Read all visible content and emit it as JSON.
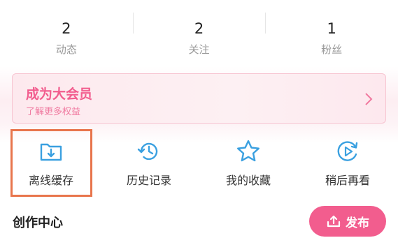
{
  "stats": [
    {
      "value": "2",
      "label": "动态"
    },
    {
      "value": "2",
      "label": "关注"
    },
    {
      "value": "1",
      "label": "粉丝"
    }
  ],
  "vip_banner": {
    "title": "成为大会员",
    "subtitle": "了解更多权益"
  },
  "menu": [
    {
      "label": "离线缓存",
      "icon": "offline-download-folder-icon",
      "highlighted": true
    },
    {
      "label": "历史记录",
      "icon": "history-clock-icon"
    },
    {
      "label": "我的收藏",
      "icon": "star-icon"
    },
    {
      "label": "稍后再看",
      "icon": "watch-later-play-icon"
    }
  ],
  "creation_center": {
    "title": "创作中心",
    "publish_label": "发布",
    "publish_icon": "upload-icon"
  },
  "colors": {
    "accent": "#f25d8e",
    "icon_blue": "#3aa0e0",
    "highlight_box": "#e8754c"
  }
}
